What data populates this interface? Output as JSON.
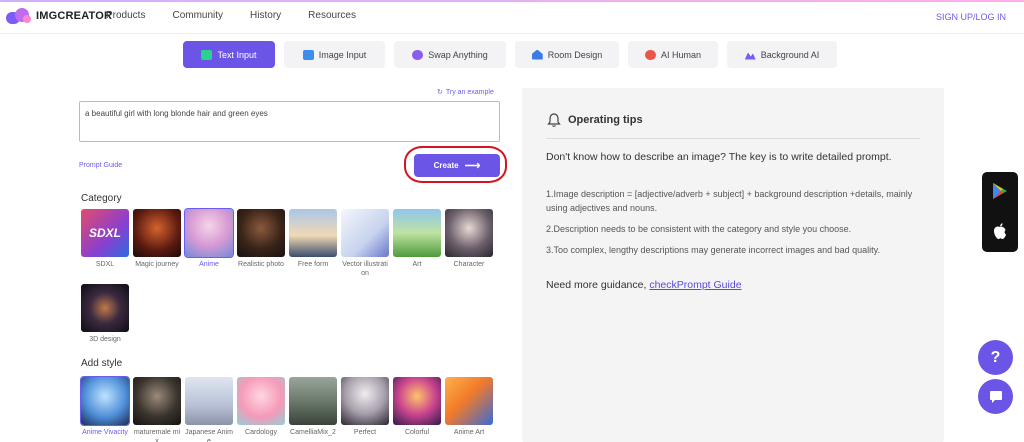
{
  "header": {
    "logo_text": "IMGCREATOR",
    "nav": [
      "Products",
      "Community",
      "History",
      "Resources"
    ],
    "login": "SIGN UP/LOG IN"
  },
  "tabs": [
    {
      "label": "Text Input",
      "icon": "text-input-icon",
      "color": "#2ad18f"
    },
    {
      "label": "Image Input",
      "icon": "image-input-icon",
      "color": "#3b8ef0"
    },
    {
      "label": "Swap Anything",
      "icon": "swap-icon",
      "color": "#8a5cf0"
    },
    {
      "label": "Room Design",
      "icon": "house-icon",
      "color": "#3a7be6"
    },
    {
      "label": "AI Human",
      "icon": "human-icon",
      "color": "#e8584a"
    },
    {
      "label": "Background AI",
      "icon": "background-icon",
      "color": "#7a5cf0"
    }
  ],
  "prompt": {
    "try_example": "Try an example",
    "value": "a beautiful girl with long blonde hair and green eyes",
    "guide": "Prompt Guide",
    "create": "Create"
  },
  "category": {
    "title": "Category",
    "items": [
      {
        "label": "SDXL",
        "thumb": "SDXL"
      },
      {
        "label": "Magic journey",
        "thumb": ""
      },
      {
        "label": "Anime",
        "thumb": ""
      },
      {
        "label": "Realistic photo",
        "thumb": ""
      },
      {
        "label": "Free form",
        "thumb": ""
      },
      {
        "label": "Vector illustration",
        "thumb": ""
      },
      {
        "label": "Art",
        "thumb": ""
      },
      {
        "label": "Character",
        "thumb": ""
      },
      {
        "label": "3D design",
        "thumb": ""
      }
    ]
  },
  "style": {
    "title": "Add style",
    "items": [
      {
        "label": "Anime Vivacity"
      },
      {
        "label": "maturemale mix"
      },
      {
        "label": "Japanese Anime"
      },
      {
        "label": "Cardology"
      },
      {
        "label": "CamelliaMix_2"
      },
      {
        "label": "Perfect"
      },
      {
        "label": "Colorful"
      },
      {
        "label": "Anime Art"
      }
    ]
  },
  "tips": {
    "title": "Operating tips",
    "intro": "Don't know how to describe an image? The key is to write detailed prompt.",
    "items": [
      "1.Image description = [adjective/adverb + subject] + background description +details, mainly using adjectives and nouns.",
      "2.Description needs to be consistent with the category and style you choose.",
      "3.Too complex, lengthy descriptions may generate incorrect images and bad quality."
    ],
    "more_prefix": "Need more guidance, ",
    "more_link": "checkPrompt Guide"
  },
  "side": {
    "help": "?"
  }
}
